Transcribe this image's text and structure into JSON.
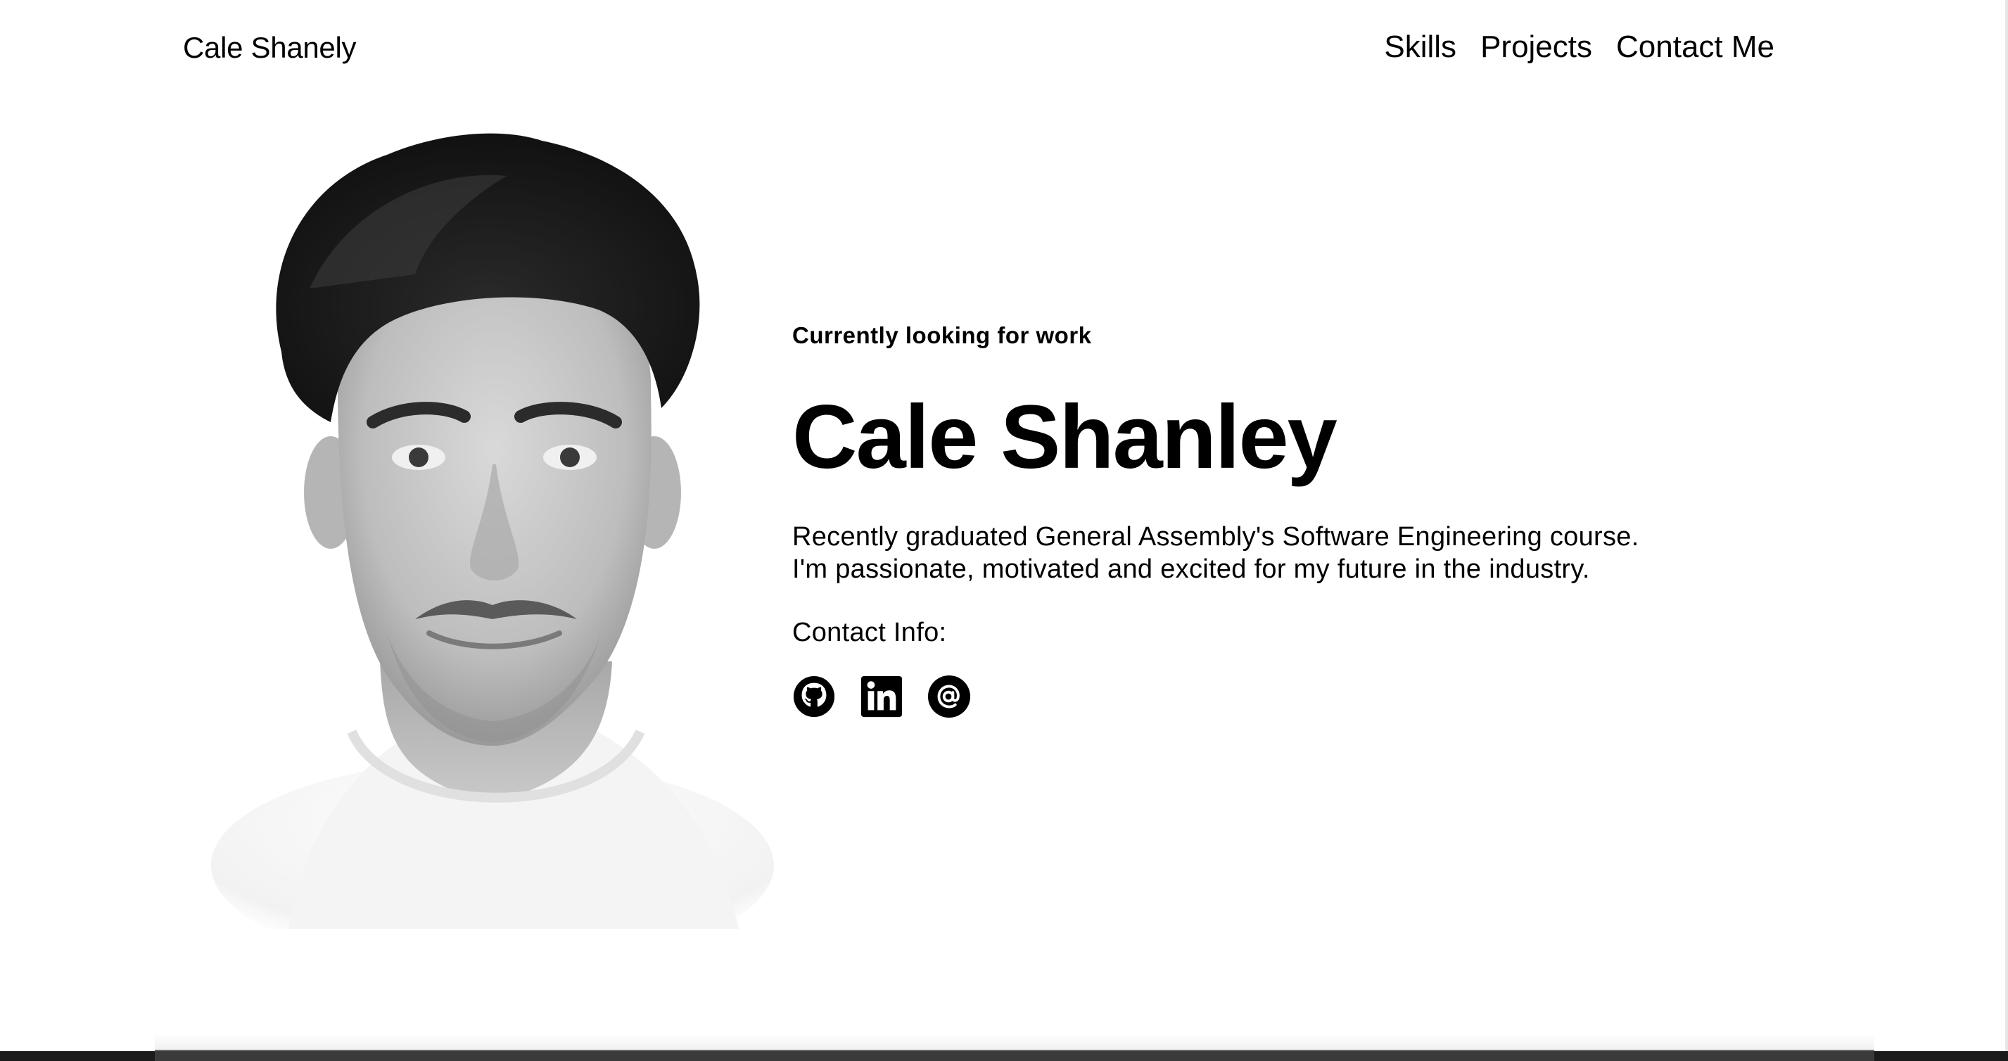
{
  "header": {
    "brand": "Cale Shanely",
    "nav": [
      {
        "label": "Skills"
      },
      {
        "label": "Projects"
      },
      {
        "label": "Contact Me"
      }
    ]
  },
  "hero": {
    "status": "Currently looking for work",
    "name": "Cale Shanley",
    "intro_line1": "Recently graduated General Assembly's Software Engineering course.",
    "intro_line2": "I'm passionate, motivated and excited for my future in the industry.",
    "contact_label": "Contact Info:",
    "social_icons": [
      "github-icon",
      "linkedin-icon",
      "email-at-icon"
    ]
  },
  "colors": {
    "background": "#ffffff",
    "text": "#000000"
  }
}
